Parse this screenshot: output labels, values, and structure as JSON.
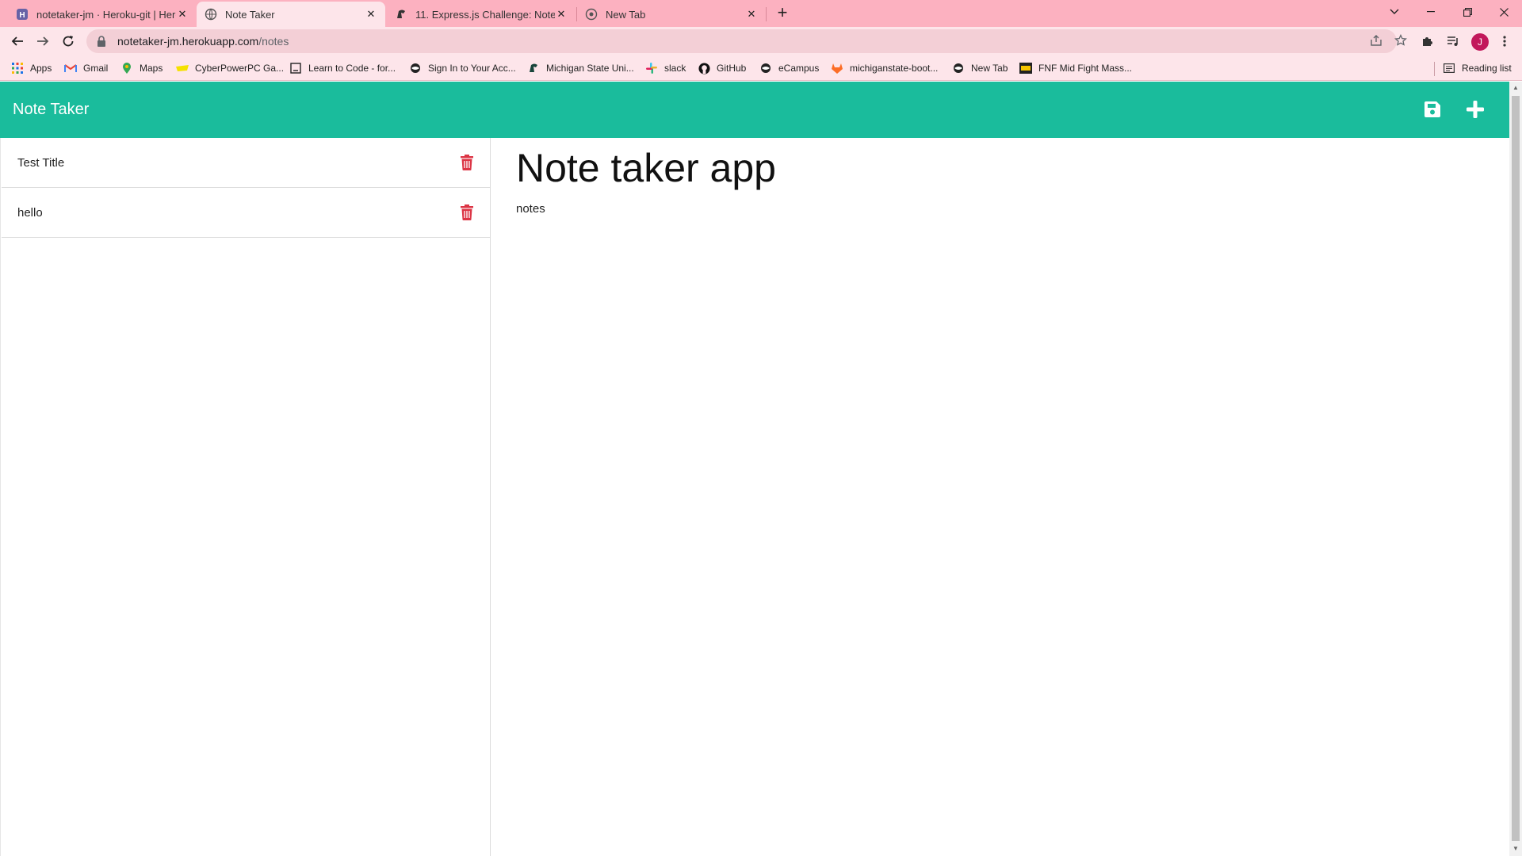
{
  "tabs": [
    {
      "title": "notetaker-jm · Heroku-git | Heroku",
      "favicon": "heroku-icon",
      "active": false
    },
    {
      "title": "Note Taker",
      "favicon": "globe-icon",
      "active": true
    },
    {
      "title": "11. Express.js Challenge: Note Taker",
      "favicon": "spartan-icon",
      "active": false
    },
    {
      "title": "New Tab",
      "favicon": "chrome-icon",
      "active": false
    }
  ],
  "toolbar": {
    "url_host": "notetaker-jm.herokuapp.com",
    "url_path": "/notes",
    "avatar_initial": "J"
  },
  "bookmarks": [
    {
      "label": "Apps",
      "icon": "apps-grid-icon"
    },
    {
      "label": "Gmail",
      "icon": "gmail-icon"
    },
    {
      "label": "Maps",
      "icon": "maps-icon"
    },
    {
      "label": "CyberPowerPC Ga...",
      "icon": "cyberpower-icon"
    },
    {
      "label": "Learn to Code - for...",
      "icon": "freecodecamp-icon"
    },
    {
      "label": "Sign In to Your Acc...",
      "icon": "globe-icon"
    },
    {
      "label": "Michigan State Uni...",
      "icon": "spartan-icon"
    },
    {
      "label": "slack",
      "icon": "slack-icon"
    },
    {
      "label": "GitHub",
      "icon": "github-icon"
    },
    {
      "label": "eCampus",
      "icon": "globe-icon"
    },
    {
      "label": "michiganstate-boot...",
      "icon": "gitlab-icon"
    },
    {
      "label": "New Tab",
      "icon": "globe-icon"
    },
    {
      "label": "FNF Mid Fight Mass...",
      "icon": "fnf-icon"
    }
  ],
  "reading_list": "Reading list",
  "app": {
    "brand": "Note Taker",
    "notes": [
      {
        "title": "Test Title"
      },
      {
        "title": "hello"
      }
    ],
    "active_note": {
      "title": "Note taker app",
      "text": "notes"
    }
  },
  "colors": {
    "header": "#1abc9c",
    "trash": "#dc3545",
    "browser_frame": "#fcb1c0"
  }
}
